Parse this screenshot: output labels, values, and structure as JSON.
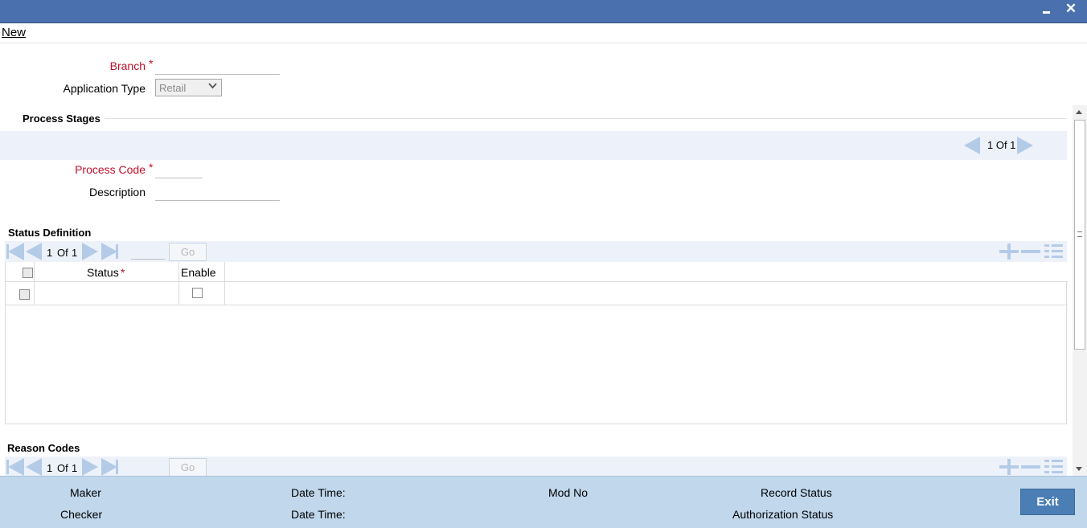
{
  "menu": {
    "new_label": "New"
  },
  "header": {
    "branch_label": "Branch",
    "branch_value": "",
    "application_type_label": "Application Type",
    "application_type_value": "Retail",
    "required_marker": "*"
  },
  "process_stages": {
    "title": "Process Stages",
    "pager_text": "1 Of 1",
    "process_code_label": "Process Code",
    "process_code_value": "",
    "description_label": "Description",
    "description_value": ""
  },
  "status_definition": {
    "title": "Status Definition",
    "pager_current": "1",
    "pager_of": "Of",
    "pager_total": "1",
    "go_label": "Go",
    "columns": {
      "status": "Status",
      "enable": "Enable"
    },
    "rows": [
      {
        "status": "",
        "enable": false
      }
    ]
  },
  "reason_codes": {
    "title": "Reason Codes",
    "pager_current": "1",
    "pager_of": "Of",
    "pager_total": "1",
    "go_label": "Go"
  },
  "footer": {
    "maker_label": "Maker",
    "checker_label": "Checker",
    "date_time_label_1": "Date Time:",
    "date_time_label_2": "Date Time:",
    "mod_no_label": "Mod No",
    "record_status_label": "Record Status",
    "authorization_status_label": "Authorization Status",
    "exit_label": "Exit"
  },
  "colors": {
    "titlebar": "#4a71ad",
    "required_red": "#c0102a",
    "footer_bg": "#c0d7ec",
    "exit_button": "#4a7eb5",
    "icon_blue": "#b4cbe8"
  },
  "icons": [
    "minimize-icon",
    "close-icon",
    "chevron-down-icon",
    "first-page-icon",
    "prev-page-icon",
    "next-page-icon",
    "last-page-icon",
    "add-row-icon",
    "delete-row-icon",
    "single-view-icon"
  ]
}
